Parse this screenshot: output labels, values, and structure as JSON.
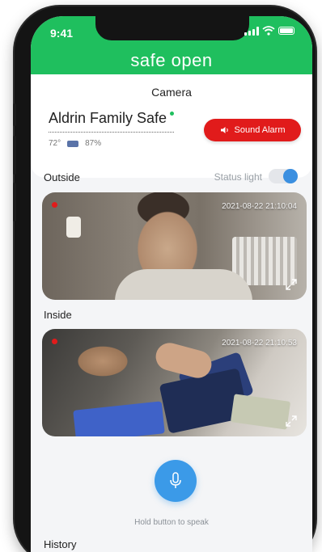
{
  "status_bar": {
    "time": "9:41"
  },
  "header": {
    "title": "safe open"
  },
  "camera": {
    "section_title": "Camera",
    "safe_name": "Aldrin Family Safe",
    "temperature": "72°",
    "battery": "87%",
    "alarm_label": "Sound Alarm"
  },
  "feeds": {
    "outside": {
      "label": "Outside",
      "timestamp": "2021-08-22  21:10:04"
    },
    "status_light_label": "Status light",
    "status_light_on": true,
    "inside": {
      "label": "Inside",
      "timestamp": "2021-08-22  21:10:53"
    }
  },
  "speak": {
    "hint": "Hold button to speak"
  },
  "history": {
    "title": "History"
  },
  "colors": {
    "brand_green": "#1fbf5e",
    "alarm_red": "#e11b1b",
    "accent_blue": "#3b9ae8"
  }
}
